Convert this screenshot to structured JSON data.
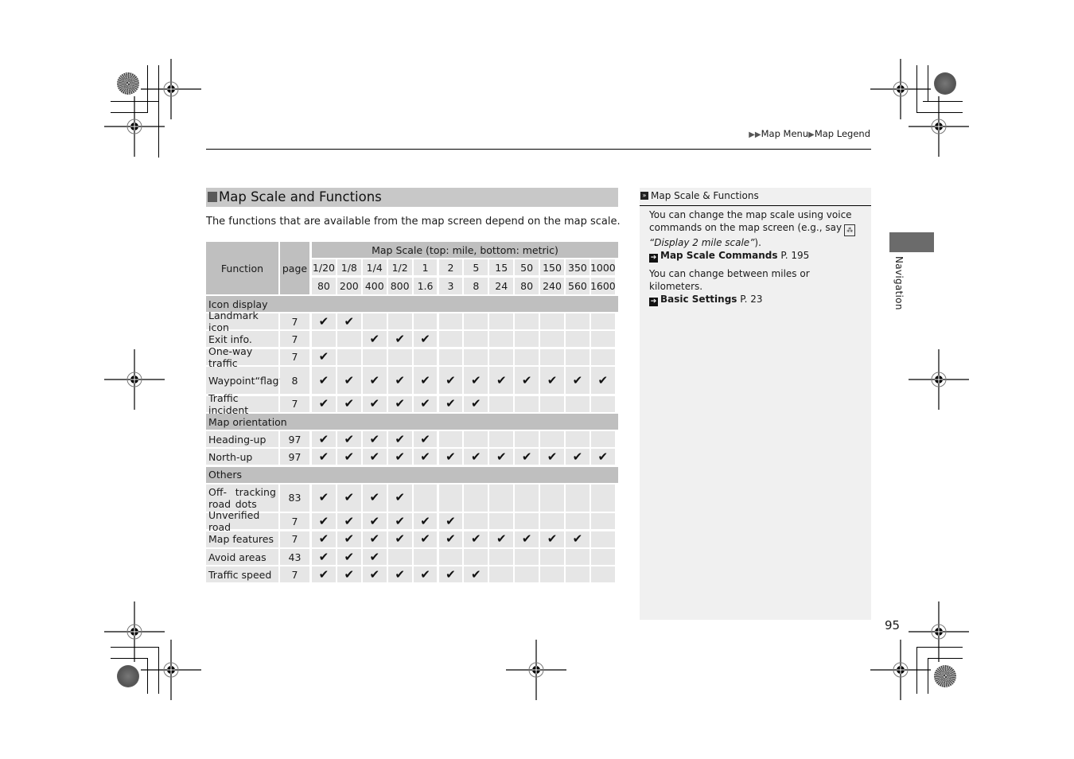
{
  "breadcrumb": [
    "Map Menu",
    "Map Legend"
  ],
  "section": {
    "title": "Map Scale and Functions",
    "intro": "The functions that are available from the map screen depend on the map scale."
  },
  "table": {
    "headers": {
      "function": "Function",
      "page": "page",
      "scale_title": "Map Scale (top: mile, bottom: metric)",
      "mile": [
        "1/20",
        "1/8",
        "1/4",
        "1/2",
        "1",
        "2",
        "5",
        "15",
        "50",
        "150",
        "350",
        "1000"
      ],
      "metric": [
        "80",
        "200",
        "400",
        "800",
        "1.6",
        "3",
        "8",
        "24",
        "80",
        "240",
        "560",
        "1600"
      ]
    },
    "check_symbol": "✔",
    "groups": [
      {
        "name": "Icon display",
        "rows": [
          {
            "function": "Landmark icon",
            "page": "7",
            "checks": [
              1,
              1,
              0,
              0,
              0,
              0,
              0,
              0,
              0,
              0,
              0,
              0
            ]
          },
          {
            "function": "Exit info.",
            "page": "7",
            "checks": [
              0,
              0,
              1,
              1,
              1,
              0,
              0,
              0,
              0,
              0,
              0,
              0
            ]
          },
          {
            "function": "One-way traffic",
            "page": "7",
            "checks": [
              1,
              0,
              0,
              0,
              0,
              0,
              0,
              0,
              0,
              0,
              0,
              0
            ]
          },
          {
            "function": "Waypoint “flag”",
            "function_lines": [
              "Waypoint",
              "“flag”"
            ],
            "page": "8",
            "checks": [
              1,
              1,
              1,
              1,
              1,
              1,
              1,
              1,
              1,
              1,
              1,
              1
            ]
          },
          {
            "function": "Traffic incident",
            "page": "7",
            "checks": [
              1,
              1,
              1,
              1,
              1,
              1,
              1,
              0,
              0,
              0,
              0,
              0
            ]
          }
        ]
      },
      {
        "name": "Map orientation",
        "rows": [
          {
            "function": "Heading-up",
            "page": "97",
            "checks": [
              1,
              1,
              1,
              1,
              1,
              0,
              0,
              0,
              0,
              0,
              0,
              0
            ]
          },
          {
            "function": "North-up",
            "page": "97",
            "checks": [
              1,
              1,
              1,
              1,
              1,
              1,
              1,
              1,
              1,
              1,
              1,
              1
            ]
          }
        ]
      },
      {
        "name": "Others",
        "rows": [
          {
            "function": "Off-road tracking dots",
            "function_lines": [
              "Off-road",
              "tracking dots"
            ],
            "page": "83",
            "checks": [
              1,
              1,
              1,
              1,
              0,
              0,
              0,
              0,
              0,
              0,
              0,
              0
            ]
          },
          {
            "function": "Unverified road",
            "page": "7",
            "checks": [
              1,
              1,
              1,
              1,
              1,
              1,
              0,
              0,
              0,
              0,
              0,
              0
            ]
          },
          {
            "function": "Map features",
            "page": "7",
            "checks": [
              1,
              1,
              1,
              1,
              1,
              1,
              1,
              1,
              1,
              1,
              1,
              0
            ]
          },
          {
            "function": "Avoid areas",
            "page": "43",
            "checks": [
              1,
              1,
              1,
              0,
              0,
              0,
              0,
              0,
              0,
              0,
              0,
              0
            ]
          },
          {
            "function": "Traffic speed",
            "page": "7",
            "checks": [
              1,
              1,
              1,
              1,
              1,
              1,
              1,
              0,
              0,
              0,
              0,
              0
            ]
          }
        ]
      }
    ]
  },
  "side_note": {
    "title": "Map Scale & Functions",
    "para1_text": "You can change the map scale using voice commands on the map screen (e.g., say",
    "para1_quote": "“Display 2 mile scale”",
    "para1_end": ").",
    "ref1_label": "Map Scale Commands",
    "ref1_page": "P. 195",
    "para2_text": "You can change between miles or kilometers.",
    "ref2_label": "Basic Settings",
    "ref2_page": "P. 23"
  },
  "tab_label": "Navigation",
  "page_number": "95"
}
